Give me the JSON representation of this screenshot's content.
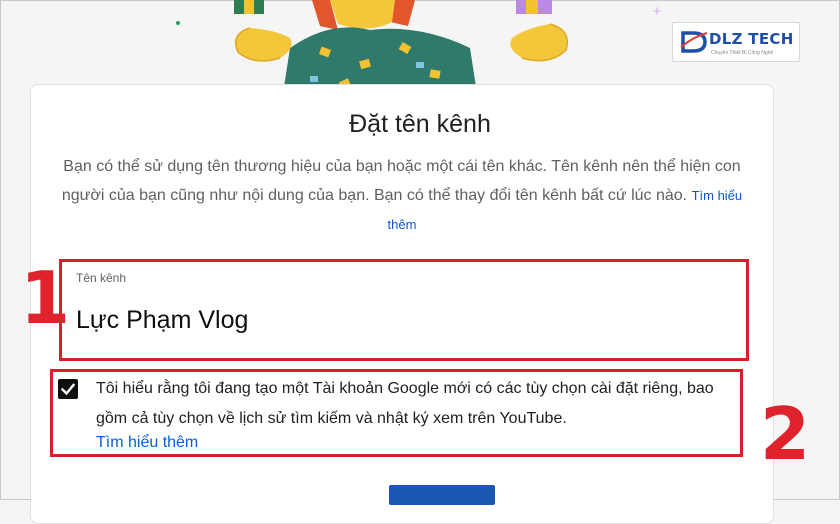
{
  "logo": {
    "name": "DLZ TECH",
    "tagline": "Chuyên Thiết Bị Công Nghệ"
  },
  "dialog": {
    "title": "Đặt tên kênh",
    "description": "Bạn có thể sử dụng tên thương hiệu của bạn hoặc một cái tên khác. Tên kênh nên thể hiện con người của bạn cũng như nội dung của bạn. Bạn có thể thay đổi tên kênh bất cứ lúc nào.",
    "learn_more": "Tìm hiểu thêm"
  },
  "channel_field": {
    "label": "Tên kênh",
    "value": "Lực Phạm Vlog"
  },
  "consent": {
    "checked": true,
    "text": "Tôi hiểu rằng tôi đang tạo một Tài khoản Google mới có các tùy chọn cài đặt riêng, bao gồm cả tùy chọn về lịch sử tìm kiếm và nhật ký xem trên YouTube.",
    "link": "Tìm hiểu thêm"
  },
  "annotations": {
    "step1": "1",
    "step2": "2",
    "color": "#d6212b"
  },
  "colors": {
    "link": "#065fd4",
    "button": "#1a57b5"
  }
}
